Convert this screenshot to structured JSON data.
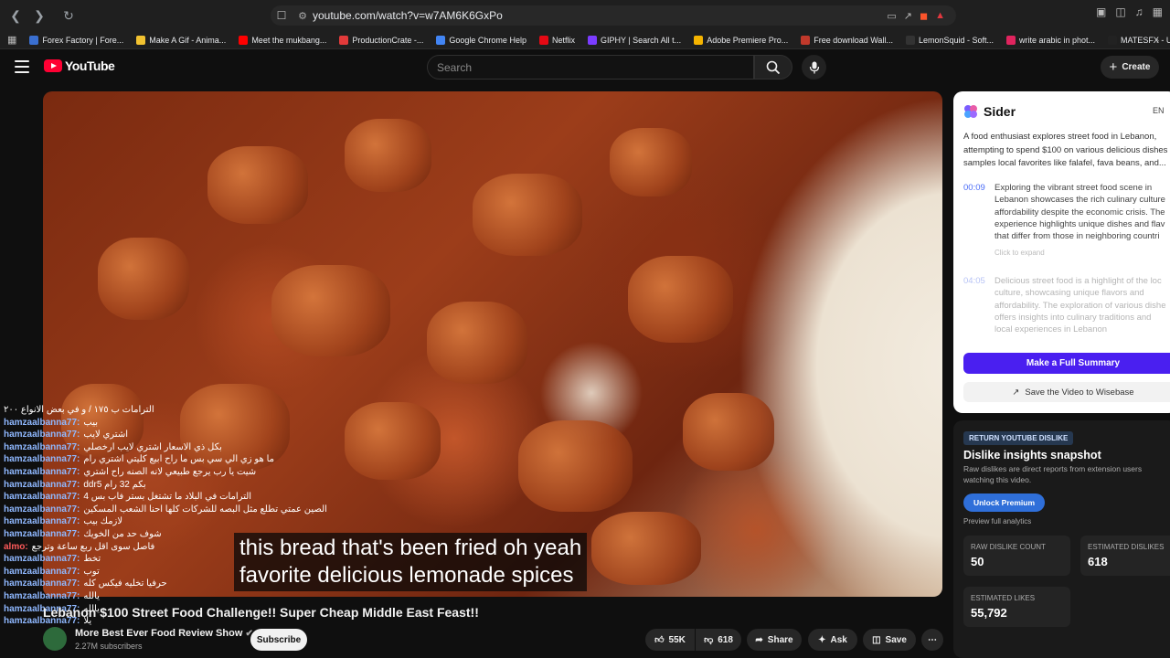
{
  "browser": {
    "url": "youtube.com/watch?v=w7AM6K6GxPo",
    "bookmarks": [
      {
        "label": "Forex Factory | Fore...",
        "color": "#3a6fd0"
      },
      {
        "label": "Make A Gif - Anima...",
        "color": "#f2c230"
      },
      {
        "label": "Meet the mukbang...",
        "color": "#ff0000"
      },
      {
        "label": "ProductionCrate -...",
        "color": "#e23a3a"
      },
      {
        "label": "Google Chrome Help",
        "color": "#4285f4"
      },
      {
        "label": "Netflix",
        "color": "#e50914"
      },
      {
        "label": "GIPHY | Search All t...",
        "color": "#7b3cff"
      },
      {
        "label": "Adobe Premiere Pro...",
        "color": "#f5b400"
      },
      {
        "label": "Free download Wall...",
        "color": "#c0392b"
      },
      {
        "label": "LemonSquid - Soft...",
        "color": "#333333"
      },
      {
        "label": "write arabic in phot...",
        "color": "#e0245e"
      },
      {
        "label": "MATESFX - Unlimite...",
        "color": "#222222"
      }
    ]
  },
  "youtube": {
    "logo_text": "YouTube",
    "search_placeholder": "Search",
    "create_label": "Create"
  },
  "video": {
    "subtitle_line1": "this bread that's been fried oh yeah",
    "subtitle_line2": "favorite delicious lemonade spices",
    "title": "Lebanon $100 Street Food Challenge!! Super Cheap Middle East Feast!!",
    "channel_name": "More Best Ever Food Review Show",
    "channel_subs": "2.27M subscribers",
    "subscribe_label": "Subscribe",
    "likes": "55K",
    "dislikes": "618",
    "share_label": "Share",
    "ask_label": "Ask",
    "save_label": "Save"
  },
  "chat": [
    {
      "user": "",
      "msg": "الترامات ب ١٧٥ / و في بعض الانواع ٢٠٠"
    },
    {
      "user": "hamzaalbanna77:",
      "msg": "بيب"
    },
    {
      "user": "hamzaalbanna77:",
      "msg": "اشتري لايب"
    },
    {
      "user": "hamzaalbanna77:",
      "msg": "بكل ذي الاسعار اشتري لايب ارخصلي"
    },
    {
      "user": "hamzaalbanna77:",
      "msg": "ما هو زي الي سي بس ما راح ابيع كليتي اشتري رام"
    },
    {
      "user": "hamzaalbanna77:",
      "msg": "شيت يا رب يرجع طبيعي لانه الصنه راح اشتري"
    },
    {
      "user": "hamzaalbanna77:",
      "msg": "بكم 32 رام ddr5"
    },
    {
      "user": "hamzaalbanna77:",
      "msg": "الترامات في البلاد ما تشتغل بستر فاب بس 4"
    },
    {
      "user": "hamzaalbanna77:",
      "msg": "الصين عمتي تطلع مثل البصه للشركات كلها احنا الشعب المسكين"
    },
    {
      "user": "hamzaalbanna77:",
      "msg": "لازمك بيب"
    },
    {
      "user": "hamzaalbanna77:",
      "msg": "شوف حد من الخويك"
    },
    {
      "user": "almo:",
      "msg": "فاصل سوى اقل ربع ساعة وترجع"
    },
    {
      "user": "hamzaalbanna77:",
      "msg": "تخط"
    },
    {
      "user": "hamzaalbanna77:",
      "msg": "توب"
    },
    {
      "user": "hamzaalbanna77:",
      "msg": "حرفيا تخليه فيكس كله"
    },
    {
      "user": "hamzaalbanna77:",
      "msg": "يالله"
    },
    {
      "user": "hamzaalbanna77:",
      "msg": "يالله"
    },
    {
      "user": "hamzaalbanna77:",
      "msg": "يلا"
    }
  ],
  "sider": {
    "brand": "Sider",
    "lang": "EN",
    "summary": [
      "A food enthusiast explores street food in Lebanon,",
      "attempting to spend $100 on various delicious dishes",
      "samples local favorites like falafel, fava beans, and..."
    ],
    "item1_time": "00:09",
    "item1_lines": [
      "Exploring the vibrant street food scene in",
      "Lebanon showcases the rich culinary culture",
      "affordability despite the economic crisis. The",
      "experience highlights unique dishes and flav",
      "that differ from those in neighboring countri"
    ],
    "expand_label": "Click to expand",
    "item2_time": "04:05",
    "item2_lines": [
      "Delicious street food is a highlight of the loc",
      "culture, showcasing unique flavors and",
      "affordability. The exploration of various dishe",
      "offers insights into culinary traditions and",
      "local experiences in Lebanon"
    ],
    "make_summary": "Make a Full Summary",
    "save_wisebase": "Save the Video to Wisebase"
  },
  "ryd": {
    "tag": "RETURN YOUTUBE DISLIKE",
    "title": "Dislike insights snapshot",
    "desc": "Raw dislikes are direct reports from extension users watching this video.",
    "unlock": "Unlock Premium",
    "preview": "Preview full analytics",
    "raw_label": "RAW DISLIKE COUNT",
    "raw_value": "50",
    "est_dis_label": "ESTIMATED DISLIKES",
    "est_dis_value": "618",
    "est_likes_label": "ESTIMATED LIKES",
    "est_likes_value": "55,792"
  }
}
